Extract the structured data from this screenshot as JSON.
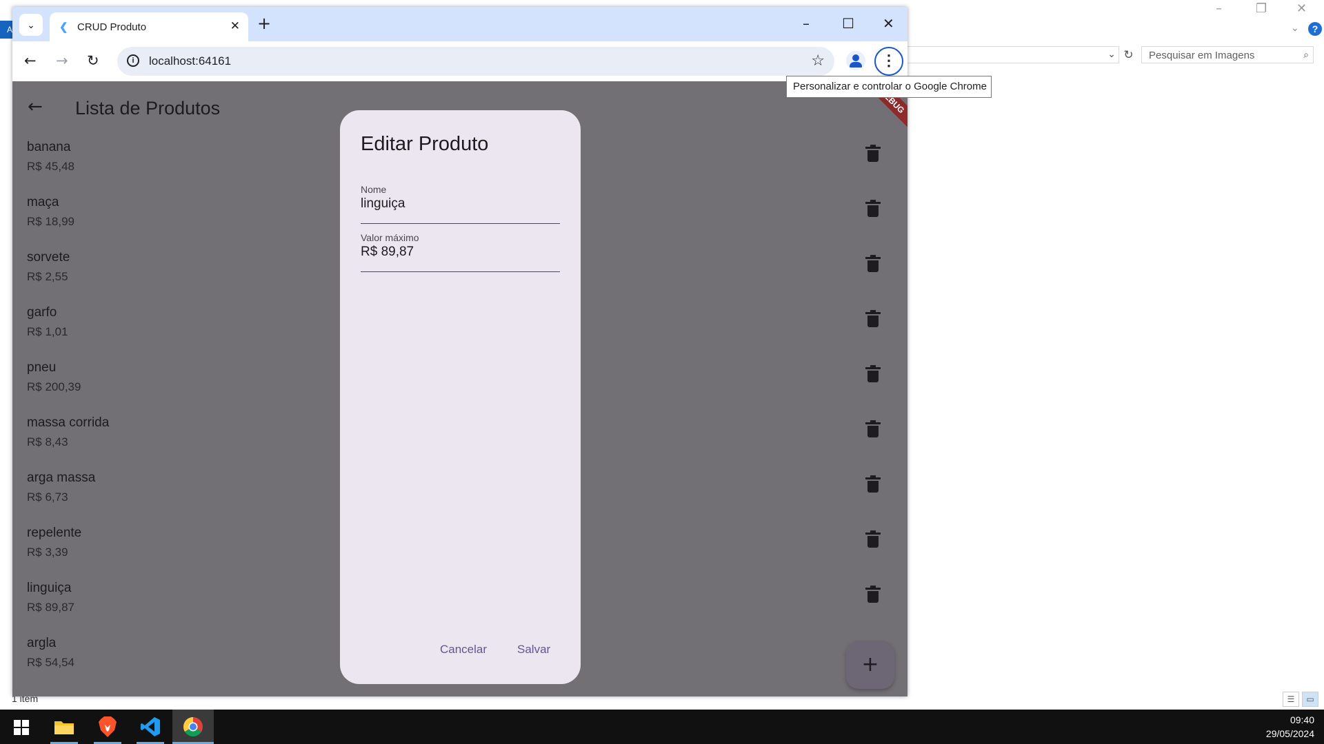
{
  "background_window": {
    "search_placeholder": "Pesquisar em Imagens",
    "status_text": "1 item",
    "left_strip_letter": "A",
    "help_label": "?"
  },
  "browser": {
    "tab_title": "CRUD Produto",
    "url": "localhost:64161",
    "menu_tooltip": "Personalizar e controlar o Google Chrome"
  },
  "app": {
    "title": "Lista de Produtos",
    "debug_banner": "DEBUG",
    "products": [
      {
        "name": "banana",
        "price": "R$ 45,48"
      },
      {
        "name": "maça",
        "price": "R$ 18,99"
      },
      {
        "name": "sorvete",
        "price": "R$ 2,55"
      },
      {
        "name": "garfo",
        "price": "R$ 1,01"
      },
      {
        "name": "pneu",
        "price": "R$ 200,39"
      },
      {
        "name": "massa corrida",
        "price": "R$ 8,43"
      },
      {
        "name": "arga massa",
        "price": "R$ 6,73"
      },
      {
        "name": "repelente",
        "price": "R$ 3,39"
      },
      {
        "name": "linguiça",
        "price": "R$ 89,87"
      },
      {
        "name": "argla",
        "price": "R$ 54,54"
      }
    ],
    "fab_icon": "add-icon"
  },
  "dialog": {
    "title": "Editar Produto",
    "fields": {
      "nome_label": "Nome",
      "nome_value": "linguiça",
      "valor_label": "Valor máximo",
      "valor_value": "R$ 89,87"
    },
    "cancel_label": "Cancelar",
    "save_label": "Salvar"
  },
  "taskbar": {
    "time": "09:40",
    "date": "29/05/2024"
  },
  "colors": {
    "scrim": "#727075",
    "dialog_bg": "#ece6f0",
    "accent": "#65558f",
    "tabstrip": "#d3e3fd"
  }
}
